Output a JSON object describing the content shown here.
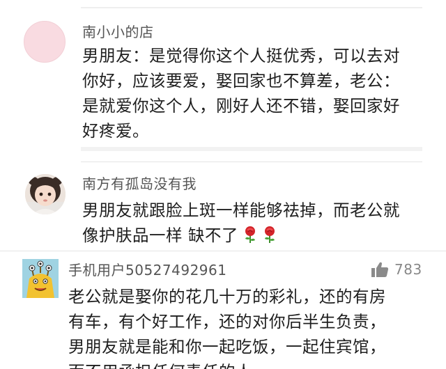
{
  "comments": [
    {
      "username": "南小小的店",
      "avatar": "pink-circle-avatar",
      "lines": [
        "男朋友：是觉得你这个人挺优秀，可以去对",
        "你好，应该要爱，娶回家也不算差，老公：",
        "是就爱你这个人，刚好人还不错，娶回家好",
        "好疼爱。"
      ]
    },
    {
      "username": "南方有孤岛没有我",
      "avatar": "little-girl-avatar",
      "lines": [
        "男朋友就跟脸上斑一样能够祛掉，而老公就",
        "像护肤品一样 缺不了"
      ],
      "emoji": "rose-icon"
    },
    {
      "username": "手机用户50527492961",
      "avatar": "monster-avatar",
      "likes": "783",
      "like_icon": "thumbs-up-icon",
      "lines": [
        "老公就是娶你的花几十万的彩礼，还的有房",
        "有车，有个好工作，还的对你后半生负责，",
        "男朋友就是能和你一起吃饭，一起住宾馆，",
        "而不用承担任何责任的人"
      ]
    }
  ],
  "colors": {
    "username": "#555555",
    "text": "#1e1e1e",
    "like": "#888888",
    "divider": "#e4e4e4"
  }
}
